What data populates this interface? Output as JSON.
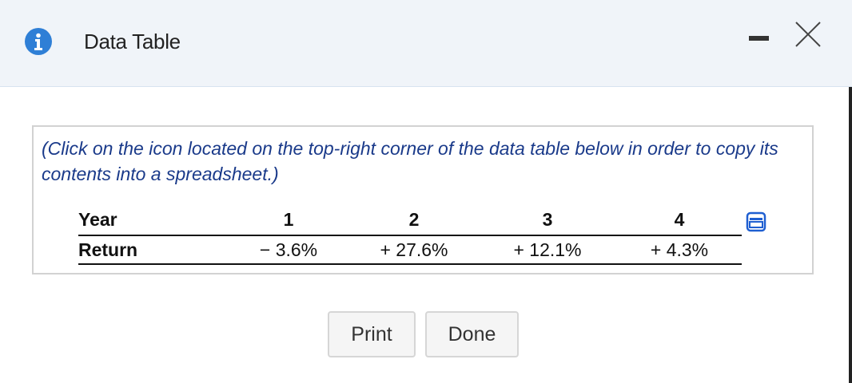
{
  "dialog": {
    "title": "Data Table",
    "accent_color": "#2f7fd6"
  },
  "instruction": "(Click on the icon located on the top-right corner of the data table below in order to copy its contents into a spreadsheet.)",
  "table": {
    "header_label": "Year",
    "row_label": "Return",
    "years": [
      "1",
      "2",
      "3",
      "4"
    ],
    "returns": [
      "− 3.6%",
      "+ 27.6%",
      "+ 12.1%",
      "+ 4.3%"
    ]
  },
  "buttons": {
    "print": "Print",
    "done": "Done"
  },
  "icons": {
    "info": "info-icon",
    "minimize": "minimize-icon",
    "close": "close-icon",
    "copy": "copy-icon"
  }
}
